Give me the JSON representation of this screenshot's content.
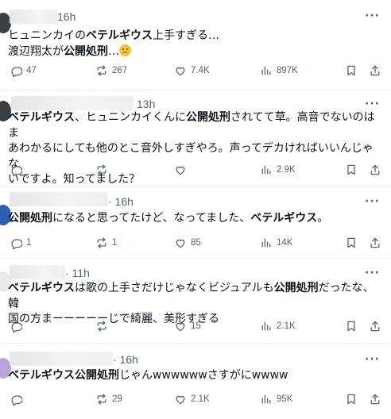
{
  "posts": [
    {
      "time": "16h",
      "text_parts": [
        {
          "t": "ヒュニンカイの",
          "b": false
        },
        {
          "t": "ベテルギウス",
          "b": true
        },
        {
          "t": "上手すぎる…",
          "b": false
        },
        {
          "t": "\n渡辺翔太が",
          "b": false
        },
        {
          "t": "公開処刑",
          "b": true
        },
        {
          "t": "…",
          "b": false
        }
      ],
      "emoji": "disappointed-face",
      "replies": "47",
      "reposts": "267",
      "likes": "7.4K",
      "views": "897K"
    },
    {
      "time": "13h",
      "text_parts": [
        {
          "t": "ベテルギウス",
          "b": true
        },
        {
          "t": "、ヒュニンカイくんに",
          "b": false
        },
        {
          "t": "公開処刑",
          "b": true
        },
        {
          "t": "されてて草。高音でないのはま\nあわかるにしても他のとこ音外しすぎやろ。声ってデカければいいんじゃな\nいですよ。知ってました？",
          "b": false
        }
      ],
      "replies": "",
      "reposts": "",
      "likes": "",
      "views": "2.9K"
    },
    {
      "time": "· 16h",
      "text_parts": [
        {
          "t": "公開処刑",
          "b": true
        },
        {
          "t": "になると思ってたけど、なってました、",
          "b": false
        },
        {
          "t": "ベテルギウス",
          "b": true
        },
        {
          "t": "。",
          "b": false
        }
      ],
      "replies": "1",
      "reposts": "1",
      "likes": "85",
      "views": "14K"
    },
    {
      "time": "· 11h",
      "text_parts": [
        {
          "t": "ベテルギウス",
          "b": true
        },
        {
          "t": "は歌の上手さだけじゃなくビジュアルも",
          "b": false
        },
        {
          "t": "公開処刑",
          "b": true
        },
        {
          "t": "だったな、韓\n国の方まーーーーーじで綺麗、美形すぎる",
          "b": false
        }
      ],
      "replies": "",
      "reposts": "",
      "likes": "15",
      "views": "2.1K"
    },
    {
      "time": "· 16h",
      "text_parts": [
        {
          "t": "ベテルギウス",
          "b": true
        },
        {
          "t": "公開処刑",
          "b": true
        },
        {
          "t": "じゃんwwwwwwさすがにwwww",
          "b": false
        }
      ],
      "replies": "",
      "reposts": "29",
      "likes": "2.1K",
      "views": "95K"
    }
  ],
  "more_label": "···",
  "icons": {
    "reply": "reply-icon",
    "repost": "repost-icon",
    "like": "like-icon",
    "views": "views-icon",
    "bookmark": "bookmark-icon",
    "share": "share-icon"
  }
}
